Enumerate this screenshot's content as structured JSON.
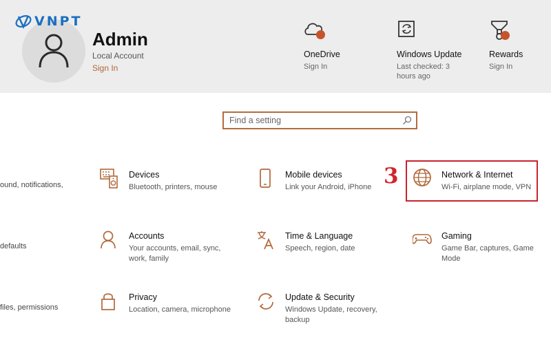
{
  "logo": {
    "text": "VNPT"
  },
  "account": {
    "name": "Admin",
    "type": "Local Account",
    "sign_in": "Sign In"
  },
  "services": [
    {
      "title": "OneDrive",
      "subtitle": "Sign In",
      "icon": "cloud-icon"
    },
    {
      "title": "Windows Update",
      "subtitle": "Last checked: 3 hours ago",
      "icon": "sync-icon"
    },
    {
      "title": "Rewards",
      "subtitle": "Sign In",
      "icon": "trophy-icon"
    }
  ],
  "search": {
    "placeholder": "Find a setting"
  },
  "partial_left": {
    "row1": "ound, notifications,",
    "row2": "defaults",
    "row3": "files, permissions"
  },
  "tiles": {
    "devices": {
      "title": "Devices",
      "desc": "Bluetooth, printers, mouse"
    },
    "mobile": {
      "title": "Mobile devices",
      "desc": "Link your Android, iPhone"
    },
    "network": {
      "title": "Network & Internet",
      "desc": "Wi-Fi, airplane mode, VPN"
    },
    "accounts": {
      "title": "Accounts",
      "desc": "Your accounts, email, sync, work, family"
    },
    "time": {
      "title": "Time & Language",
      "desc": "Speech, region, date"
    },
    "gaming": {
      "title": "Gaming",
      "desc": "Game Bar, captures, Game Mode"
    },
    "privacy": {
      "title": "Privacy",
      "desc": "Location, camera, microphone"
    },
    "update": {
      "title": "Update & Security",
      "desc": "Windows Update, recovery, backup"
    }
  },
  "annotation": {
    "step": "3"
  },
  "colors": {
    "accent": "#b0683a",
    "highlight": "#c8232c",
    "brand": "#1b6fc2",
    "badge": "#c7532a"
  }
}
